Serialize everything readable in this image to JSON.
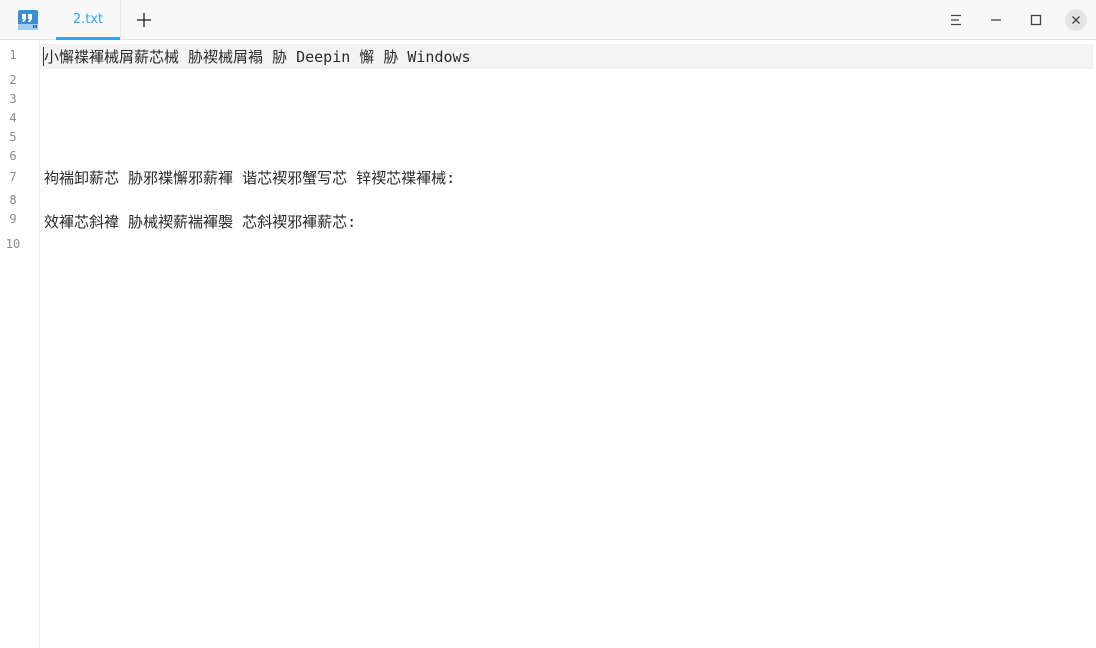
{
  "titlebar": {
    "tab_label": "2.txt",
    "add_tab_icon": "plus-icon",
    "app_icon": "text-editor-icon",
    "menu_icon": "menu-icon",
    "minimize_icon": "minimize-icon",
    "maximize_icon": "maximize-icon",
    "close_icon": "close-icon",
    "accent_color": "#2ca7f8"
  },
  "editor": {
    "lines": [
      {
        "num": "1",
        "text": "小懈褋褌械屑薪芯械 胁褉械屑褟 胁 Deepin 懈 胁 Windows"
      },
      {
        "num": "2",
        "text": ""
      },
      {
        "num": "3",
        "text": ""
      },
      {
        "num": "4",
        "text": ""
      },
      {
        "num": "5",
        "text": ""
      },
      {
        "num": "6",
        "text": ""
      },
      {
        "num": "7",
        "text": "袧褍卸薪芯 胁邪褋懈邪薪褌 谐芯褉邪蟹写芯 锌褉芯褋褌械:"
      },
      {
        "num": "8",
        "text": ""
      },
      {
        "num": "9",
        "text": "效褌芯斜褘 胁械褉薪褍褌褜 芯斜褉邪褌薪芯:"
      },
      {
        "num": "10",
        "text": ""
      }
    ]
  }
}
